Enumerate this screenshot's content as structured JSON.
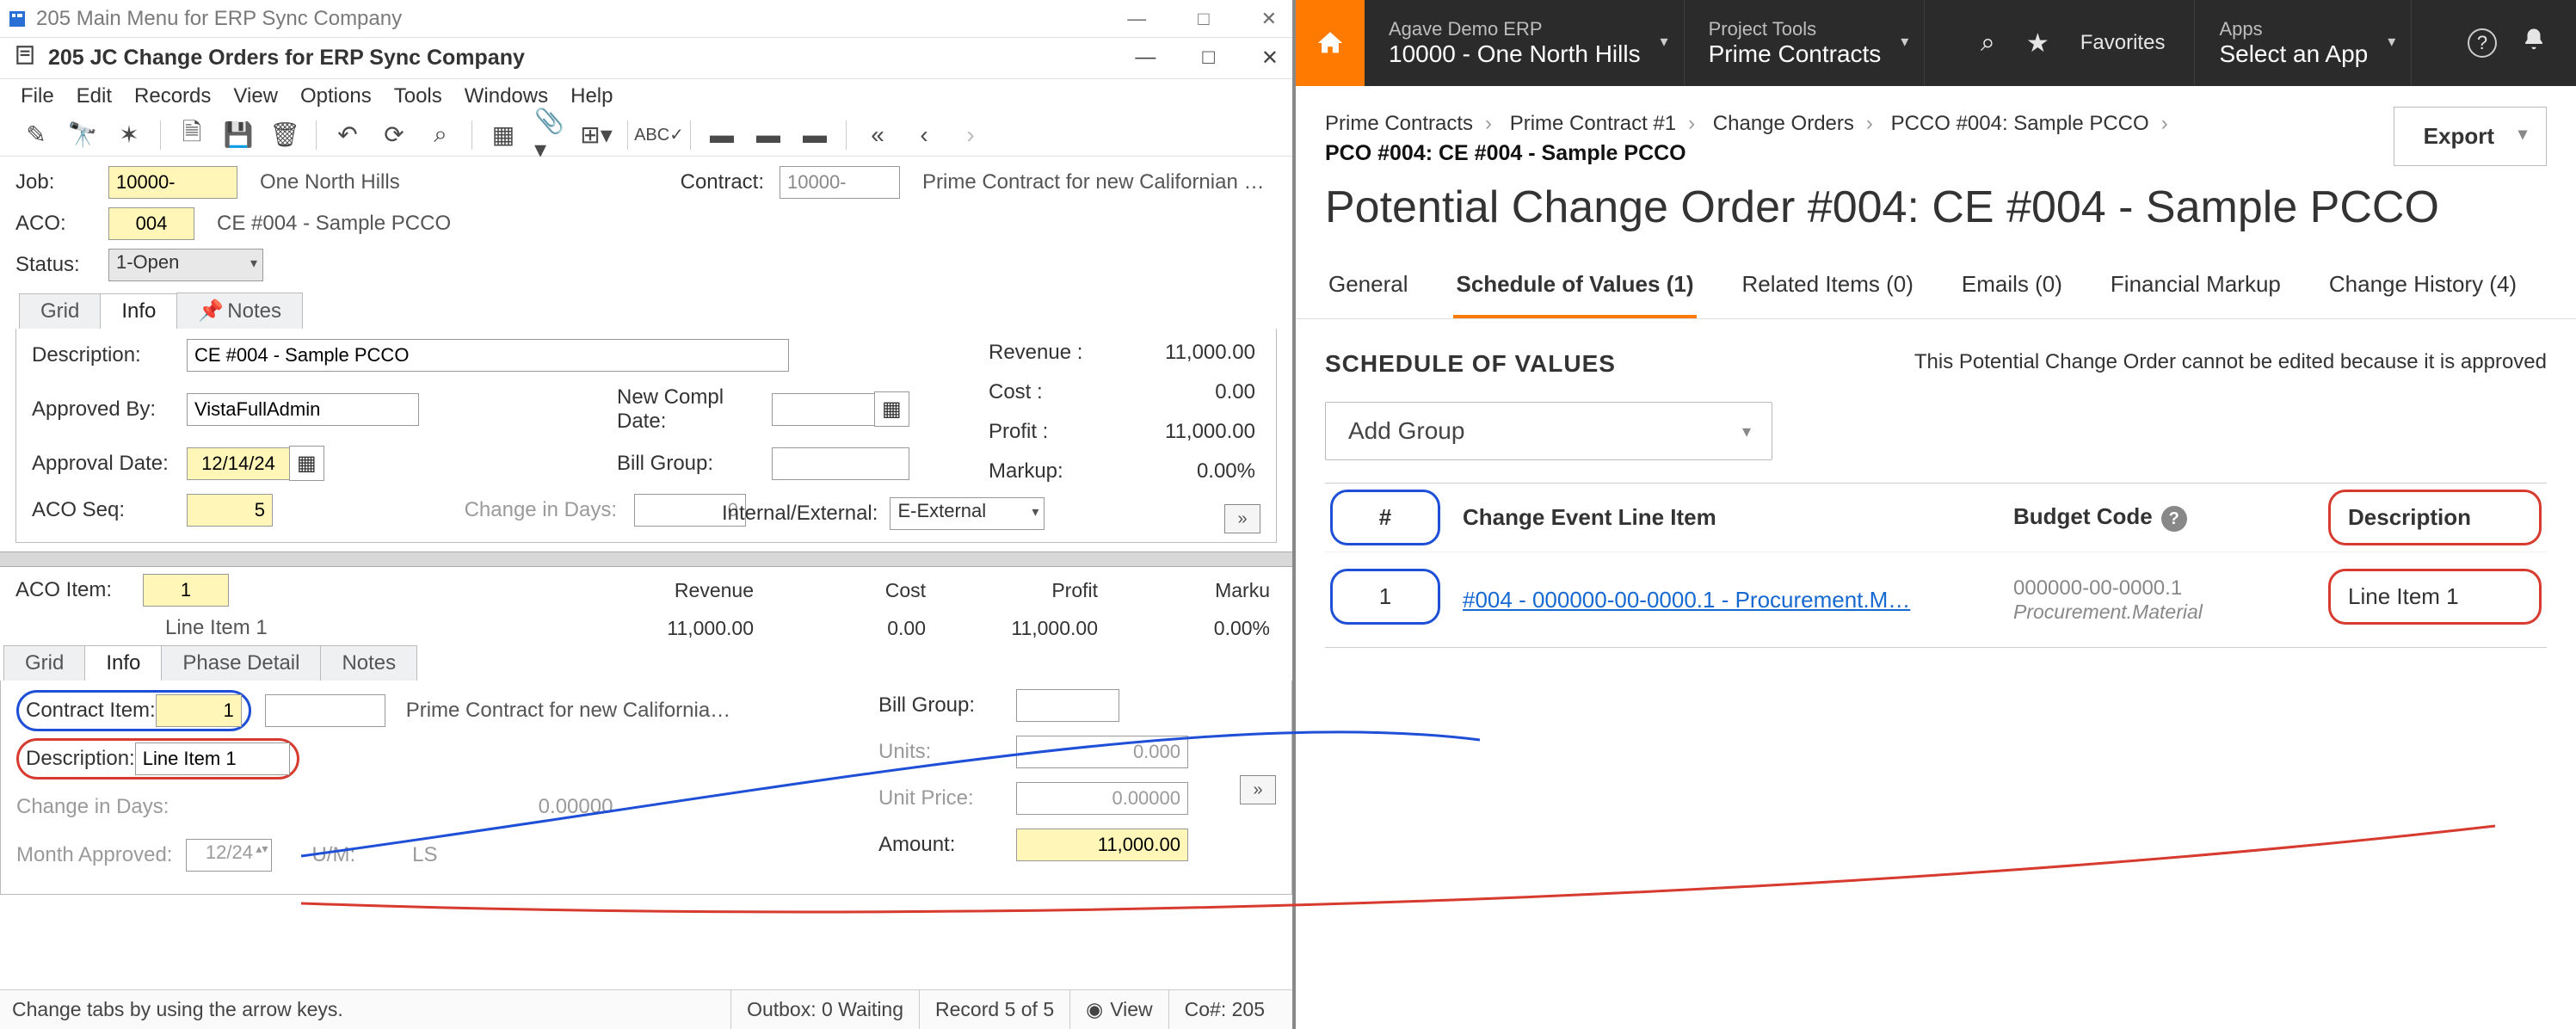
{
  "left": {
    "mainWindowTitle": "205 Main Menu for ERP Sync Company",
    "subWindowTitle": "205 JC Change Orders for ERP Sync Company",
    "winControls": {
      "min": "—",
      "max": "□",
      "close": "✕"
    },
    "menu": [
      "File",
      "Edit",
      "Records",
      "View",
      "Options",
      "Tools",
      "Windows",
      "Help"
    ],
    "toolbar": [
      "edit-square",
      "binoculars",
      "bug",
      "sep",
      "page",
      "save",
      "trash",
      "sep",
      "undo",
      "redo",
      "search",
      "sep",
      "grid-4",
      "attach",
      "table-drop",
      "sep",
      "check-spell",
      "sep",
      "card1",
      "card2",
      "card3",
      "sep",
      "chevrons-left",
      "chevron-left",
      "chevron-right"
    ],
    "header": {
      "jobLabel": "Job:",
      "jobNo": "10000-",
      "jobName": "One North Hills",
      "contractLabel": "Contract:",
      "contractNo": "10000-",
      "contractDesc": "Prime Contract for new Californian Prope…",
      "acoLabel": "ACO:",
      "acoNo": "004",
      "acoDesc": "CE #004 - Sample PCCO",
      "statusLabel": "Status:",
      "statusVal": "1-Open"
    },
    "tabs": {
      "grid": "Grid",
      "info": "Info",
      "notes": "Notes"
    },
    "details": {
      "descriptionLabel": "Description:",
      "description": "CE #004 - Sample PCCO",
      "approvedByLabel": "Approved By:",
      "approvedBy": "VistaFullAdmin",
      "approvalDateLabel": "Approval Date:",
      "approvalDate": "12/14/24",
      "acoSeqLabel": "ACO Seq:",
      "acoSeq": "5",
      "changeInDaysLabel": "Change in Days:",
      "changeInDays": "0",
      "newComplLabel": "New Compl Date:",
      "newCompl": "",
      "billGroupLabel": "Bill Group:",
      "billGroup": "",
      "intExtLabel": "Internal/External:",
      "intExt": "E-External",
      "money": {
        "revenueLabel": "Revenue  :",
        "revenue": "11,000.00",
        "costLabel": "Cost  :",
        "cost": "0.00",
        "profitLabel": "Profit  :",
        "profit": "11,000.00",
        "markupLabel": "Markup:",
        "markup": "0.00%"
      }
    },
    "acoItem": {
      "label": "ACO Item:",
      "value": "1",
      "desc": "Line Item 1",
      "cols": {
        "revenue": "Revenue",
        "cost": "Cost",
        "profit": "Profit",
        "markup": "Marku"
      },
      "row": {
        "revenue": "11,000.00",
        "cost": "0.00",
        "profit": "11,000.00",
        "markup": "0.00%"
      }
    },
    "subTabs": {
      "grid": "Grid",
      "info": "Info",
      "phase": "Phase Detail",
      "notes": "Notes"
    },
    "subDetails": {
      "contractItemLabel": "Contract Item:",
      "contractItem": "1",
      "contractItemDesc": "Prime Contract for new California…",
      "descLabel": "Description:",
      "desc": "Line Item 1",
      "cidLabel": "Change in Days:",
      "cid": "0.00000",
      "monthApprLabel": "Month Approved:",
      "monthAppr": "12/24",
      "umLabel": "U/M:",
      "um": "LS",
      "billGroupLabel": "Bill Group:",
      "billGroup": "",
      "unitsLabel": "Units:",
      "units": "0.000",
      "unitPriceLabel": "Unit Price:",
      "unitPrice": "0.00000",
      "amountLabel": "Amount:",
      "amount": "11,000.00"
    },
    "status": {
      "hint": "Change tabs by using the arrow keys.",
      "outbox": "Outbox: 0 Waiting",
      "record": "Record 5 of 5",
      "view": "View",
      "co": "Co#: 205"
    }
  },
  "right": {
    "black": {
      "erpLabel": "Agave Demo ERP",
      "erpSub": "10000 - One North Hills",
      "toolsLabel": "Project Tools",
      "toolsSub": "Prime Contracts",
      "favorites": "Favorites",
      "appsLabel": "Apps",
      "appsSub": "Select an App"
    },
    "crumbs": {
      "a": "Prime Contracts",
      "b": "Prime Contract #1",
      "c": "Change Orders",
      "d": "PCCO #004: Sample PCCO",
      "bold": "PCO #004: CE #004 - Sample PCCO",
      "export": "Export"
    },
    "title": "Potential Change Order #004: CE #004 - Sample PCCO",
    "tabs": {
      "general": "General",
      "sov": "Schedule of Values (1)",
      "related": "Related Items (0)",
      "emails": "Emails (0)",
      "fin": "Financial Markup",
      "history": "Change History (4)"
    },
    "sov": {
      "heading": "SCHEDULE OF VALUES",
      "note": "This Potential Change Order cannot be edited because it is approved",
      "addGroup": "Add Group",
      "colHash": "#",
      "colCE": "Change Event Line Item",
      "colBudget": "Budget Code",
      "colDesc": "Description",
      "row": {
        "num": "1",
        "link": "#004 - 000000-00-0000.1 - Procurement.M…",
        "budgetCode": "000000-00-0000.1",
        "budgetSub": "Procurement.Material",
        "desc": "Line Item 1"
      }
    }
  }
}
